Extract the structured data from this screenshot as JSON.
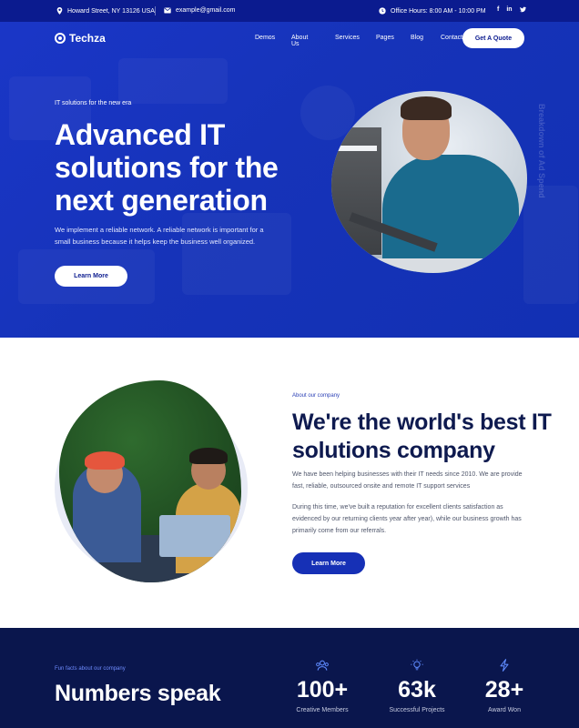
{
  "topbar": {
    "address": "Howard Street, NY 13126 USA",
    "email": "example@gmail.com",
    "hours": "Office Hours: 8:00 AM - 10:00 PM",
    "social": [
      "f",
      "in",
      "t"
    ]
  },
  "nav": {
    "logo": "Techza",
    "links": [
      "Demos",
      "About Us",
      "Services",
      "Pages",
      "Blog",
      "Contact"
    ],
    "cta": "Get A Quote"
  },
  "hero": {
    "eyebrow": "IT solutions for the new era",
    "title": "Advanced IT solutions for the next generation",
    "text": "We implement a reliable network. A reliable network is important for a small business because it helps keep the business well organized.",
    "button": "Learn More",
    "vertical_text": "Breakdown of Ad Spend"
  },
  "about": {
    "eyebrow": "About our company",
    "title": "We're the world's best IT solutions company",
    "p1": "We have been helping businesses with their IT needs since 2010. We are provide fast, reliable, outsourced onsite and remote IT support services",
    "p2": "During this time, we've built a reputation for excellent clients satisfaction as evidenced by our returning clients year after year), while our business growth has primarily come from our referrals.",
    "button": "Learn More"
  },
  "stats": {
    "eyebrow": "Fun facts about our company",
    "title": "Numbers speak",
    "items": [
      {
        "num": "100+",
        "label": "Creative Members",
        "icon": "team-icon"
      },
      {
        "num": "63k",
        "label": "Successful Projects",
        "icon": "bulb-icon"
      },
      {
        "num": "28+",
        "label": "Award Won",
        "icon": "bolt-icon"
      }
    ]
  },
  "colors": {
    "primary": "#1630b6",
    "topbar": "#0b1b8f",
    "dark": "#0a164d",
    "heading": "#0e1a4f"
  }
}
